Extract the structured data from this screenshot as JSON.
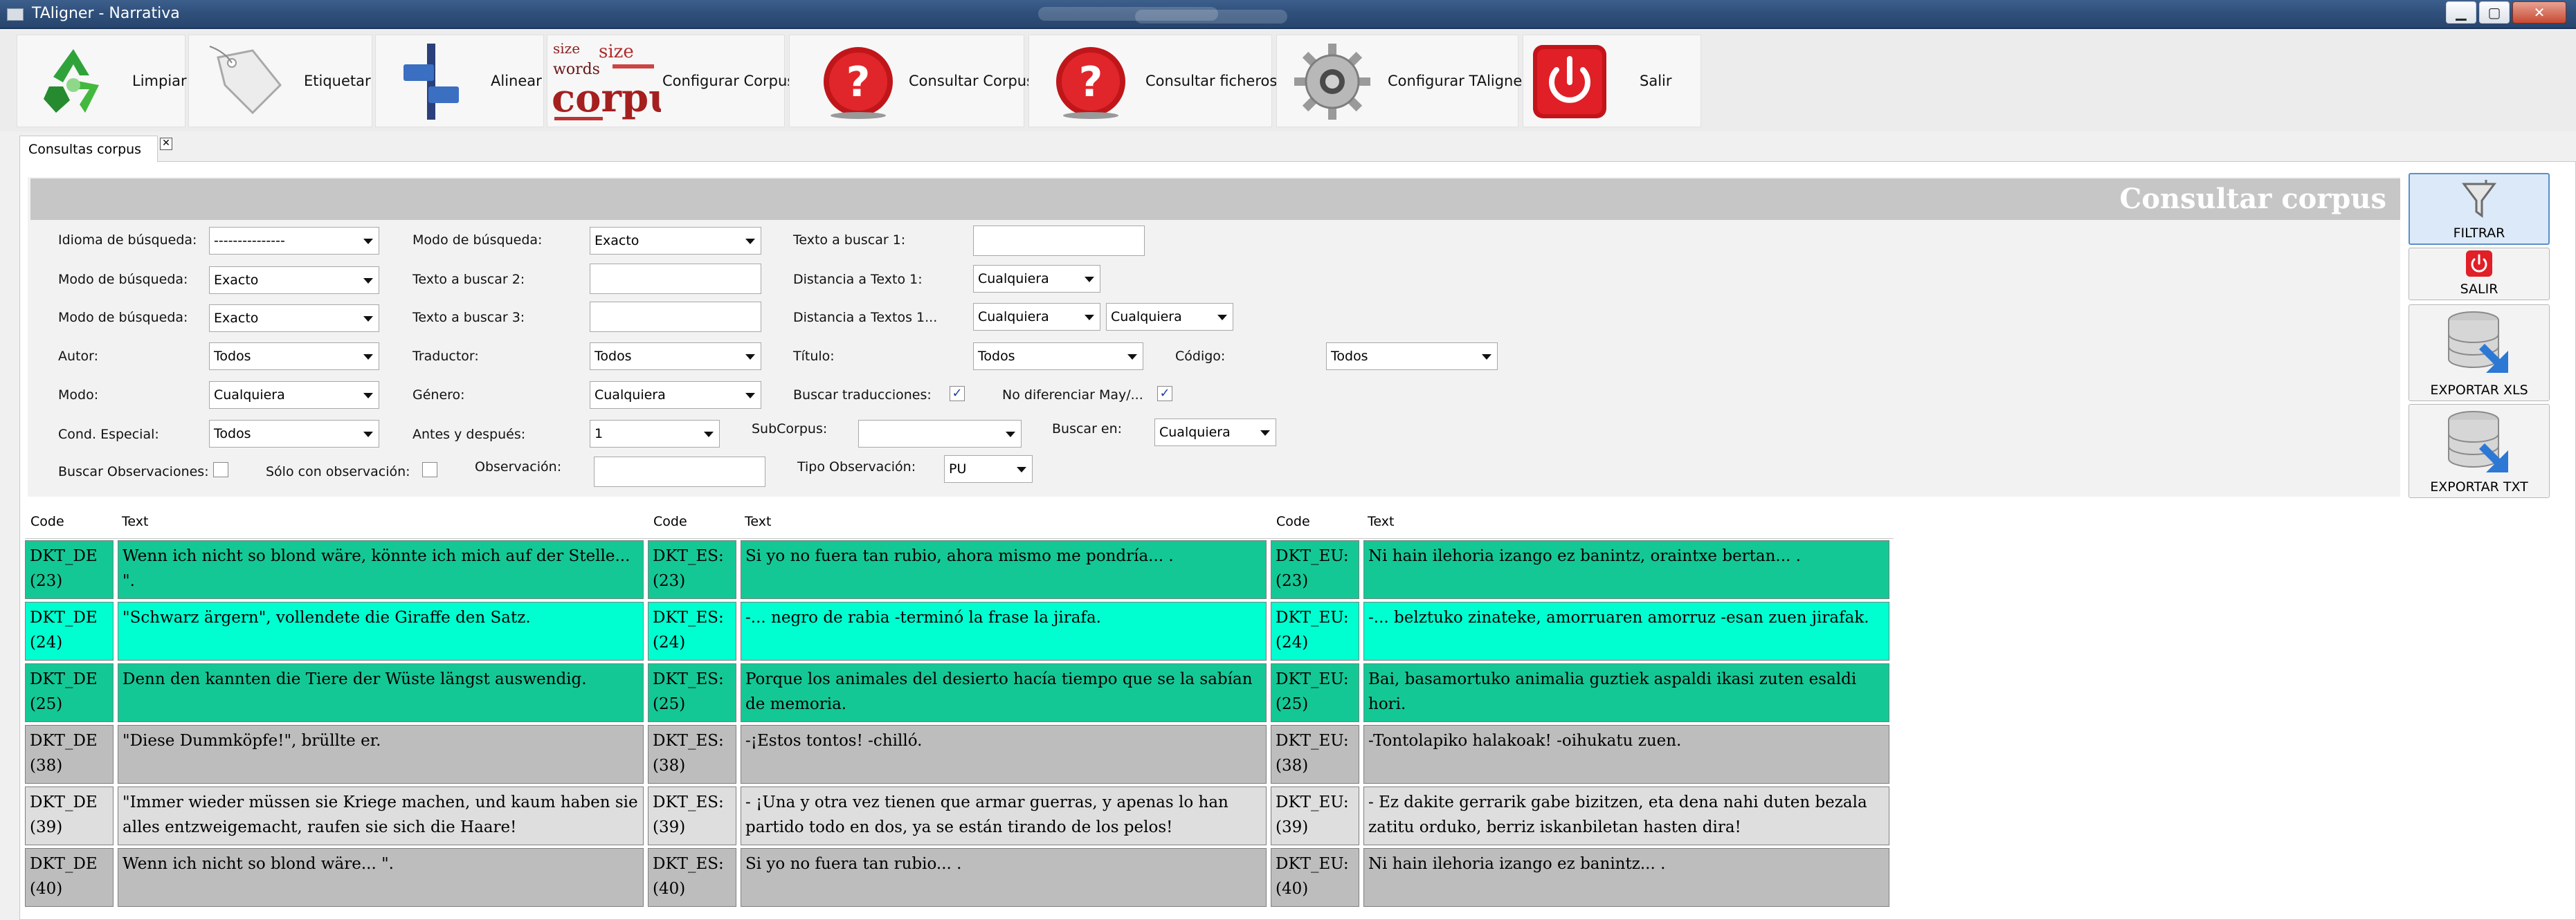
{
  "window": {
    "title": "TAligner - Narrativa",
    "minimize": "▁",
    "maximize": "▢",
    "close": "✕"
  },
  "toolbar": {
    "items": [
      {
        "label": "Limpiar",
        "icon": "recycle-icon"
      },
      {
        "label": "Etiquetar",
        "icon": "tag-icon"
      },
      {
        "label": "Alinear",
        "icon": "align-icon"
      },
      {
        "label": "Configurar Corpus",
        "icon": "corpus-wordcloud-icon"
      },
      {
        "label": "Consultar Corpus",
        "icon": "question-icon"
      },
      {
        "label": "Consultar ficheros",
        "icon": "question-icon"
      },
      {
        "label": "Configurar TAligner",
        "icon": "gear-icon"
      },
      {
        "label": "Salir",
        "icon": "power-icon"
      }
    ],
    "corpus_words": [
      "size",
      "words",
      "corpus"
    ]
  },
  "tab": {
    "label": "Consultas corpus",
    "close": "✕"
  },
  "header": {
    "title": "Consultar corpus"
  },
  "form": {
    "idioma_label": "Idioma de búsqueda:",
    "idioma_value": "---------------",
    "modo_busqueda1_label": "Modo de búsqueda:",
    "modo_busqueda1_value": "Exacto",
    "texto1_label": "Texto a buscar 1:",
    "modo_busqueda2_label": "Modo de búsqueda:",
    "modo_busqueda2_value": "Exacto",
    "texto2_label": "Texto a buscar 2:",
    "distancia1_label": "Distancia a Texto 1:",
    "distancia1_value": "Cualquiera",
    "modo_busqueda3_label": "Modo de búsqueda:",
    "modo_busqueda3_value": "Exacto",
    "texto3_label": "Texto a buscar 3:",
    "distancia2_label": "Distancia a Textos 1...",
    "distancia2a_value": "Cualquiera",
    "distancia2b_value": "Cualquiera",
    "autor_label": "Autor:",
    "autor_value": "Todos",
    "traductor_label": "Traductor:",
    "traductor_value": "Todos",
    "titulo_label": "Título:",
    "titulo_value": "Todos",
    "codigo_label": "Código:",
    "codigo_value": "Todos",
    "modo_label": "Modo:",
    "modo_value": "Cualquiera",
    "genero_label": "Género:",
    "genero_value": "Cualquiera",
    "buscar_trad_label": "Buscar traducciones:",
    "buscar_trad_checked": "✓",
    "no_dif_label": "No diferenciar May/...",
    "no_dif_checked": "✓",
    "cond_label": "Cond. Especial:",
    "cond_value": "Todos",
    "antes_label": "Antes y después:",
    "antes_value": "1",
    "subcorpus_label": "SubCorpus:",
    "subcorpus_value": "",
    "buscar_en_label": "Buscar en:",
    "buscar_en_value": "Cualquiera",
    "buscar_obs_label": "Buscar Observaciones:",
    "solo_obs_label": "Sólo con observación:",
    "observacion_label": "Observación:",
    "tipo_obs_label": "Tipo Observación:",
    "tipo_obs_value": "PU"
  },
  "side_buttons": {
    "filtrar": "FILTRAR",
    "salir": "SALIR",
    "exportar_xls": "EXPORTAR XLS",
    "exportar_txt": "EXPORTAR TXT"
  },
  "table": {
    "headers": [
      "Code",
      "Text",
      "Code",
      "Text",
      "Code",
      "Text"
    ],
    "rows": [
      {
        "c1": "DKT_DE (23)",
        "t1": "Wenn ich nicht so blond wäre, könnte ich mich auf der Stelle... \".",
        "c2": "DKT_ES: (23)",
        "t2": "Si yo no fuera tan rubio, ahora mismo me pondría... .",
        "c3": "DKT_EU: (23)",
        "t3": "Ni hain ilehoria izango ez banintz, oraintxe bertan... ."
      },
      {
        "c1": "DKT_DE (24)",
        "t1": "\"Schwarz ärgern\", vollendete die Giraffe den Satz.",
        "c2": "DKT_ES: (24)",
        "t2": "-... negro de rabia -terminó la frase la jirafa.",
        "c3": "DKT_EU: (24)",
        "t3": "-... belztuko zinateke, amorruaren amorruz -esan zuen jirafak."
      },
      {
        "c1": "DKT_DE (25)",
        "t1": "Denn den kannten die Tiere der Wüste längst auswendig.",
        "c2": "DKT_ES: (25)",
        "t2": "Porque los animales del desierto hacía tiempo que se la sabían de memoria.",
        "c3": "DKT_EU: (25)",
        "t3": "Bai, basamortuko animalia guztiek aspaldi ikasi zuten esaldi hori."
      },
      {
        "c1": "DKT_DE (38)",
        "t1": "\"Diese Dummköpfe!\", brüllte er.",
        "c2": "DKT_ES: (38)",
        "t2": "-¡Estos tontos! -chilló.",
        "c3": "DKT_EU: (38)",
        "t3": "-Tontolapiko halakoak! -oihukatu zuen."
      },
      {
        "c1": "DKT_DE (39)",
        "t1": "\"Immer wieder müssen sie Kriege machen, und kaum haben sie alles entzweigemacht, raufen sie sich die Haare!",
        "c2": "DKT_ES: (39)",
        "t2": "- ¡Una y otra vez tienen que armar guerras, y apenas lo han partido todo en dos, ya se están tirando de los pelos!",
        "c3": "DKT_EU: (39)",
        "t3": "- Ez dakite gerrarik gabe bizitzen, eta dena nahi duten bezala zatitu orduko, berriz iskanbiletan hasten dira!"
      },
      {
        "c1": "DKT_DE (40)",
        "t1": "Wenn ich nicht so blond wäre... \".",
        "c2": "DKT_ES: (40)",
        "t2": "Si yo no fuera tan rubio... .",
        "c3": "DKT_EU: (40)",
        "t3": "Ni hain ilehoria izango ez banintz... ."
      }
    ],
    "row_colors": [
      "#14c896",
      "#00ffd0",
      "#14c896",
      "#bdbdbd",
      "#dedede",
      "#bdbdbd"
    ]
  }
}
